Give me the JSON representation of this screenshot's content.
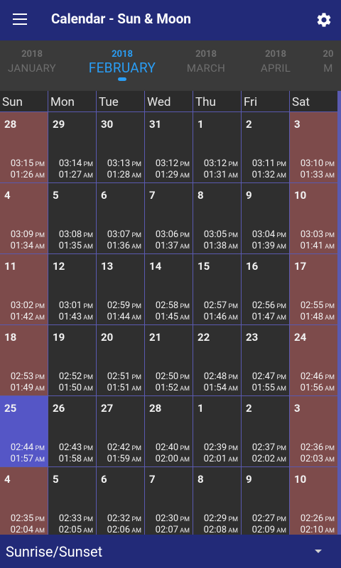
{
  "app": {
    "title": "Calendar - Sun & Moon",
    "menu_icon": "menu-icon",
    "settings_icon": "gear-icon"
  },
  "months": [
    {
      "year": "2018",
      "name": "JANUARY",
      "selected": false
    },
    {
      "year": "2018",
      "name": "FEBRUARY",
      "selected": true
    },
    {
      "year": "2018",
      "name": "MARCH",
      "selected": false
    },
    {
      "year": "2018",
      "name": "APRIL",
      "selected": false
    },
    {
      "year": "20",
      "name": "M",
      "selected": false
    }
  ],
  "weekdays": [
    "Sun",
    "Mon",
    "Tue",
    "Wed",
    "Thu",
    "Fri",
    "Sat"
  ],
  "weeks": [
    [
      {
        "day": "28",
        "t1": "03:15",
        "p1": "PM",
        "t2": "01:26",
        "p2": "AM"
      },
      {
        "day": "29",
        "t1": "03:14",
        "p1": "PM",
        "t2": "01:27",
        "p2": "AM"
      },
      {
        "day": "30",
        "t1": "03:13",
        "p1": "PM",
        "t2": "01:28",
        "p2": "AM"
      },
      {
        "day": "31",
        "t1": "03:12",
        "p1": "PM",
        "t2": "01:29",
        "p2": "AM"
      },
      {
        "day": "1",
        "t1": "03:12",
        "p1": "PM",
        "t2": "01:31",
        "p2": "AM"
      },
      {
        "day": "2",
        "t1": "03:11",
        "p1": "PM",
        "t2": "01:32",
        "p2": "AM"
      },
      {
        "day": "3",
        "t1": "03:10",
        "p1": "PM",
        "t2": "01:33",
        "p2": "AM"
      }
    ],
    [
      {
        "day": "4",
        "t1": "03:09",
        "p1": "PM",
        "t2": "01:34",
        "p2": "AM"
      },
      {
        "day": "5",
        "t1": "03:08",
        "p1": "PM",
        "t2": "01:35",
        "p2": "AM"
      },
      {
        "day": "6",
        "t1": "03:07",
        "p1": "PM",
        "t2": "01:36",
        "p2": "AM"
      },
      {
        "day": "7",
        "t1": "03:06",
        "p1": "PM",
        "t2": "01:37",
        "p2": "AM"
      },
      {
        "day": "8",
        "t1": "03:05",
        "p1": "PM",
        "t2": "01:38",
        "p2": "AM"
      },
      {
        "day": "9",
        "t1": "03:04",
        "p1": "PM",
        "t2": "01:39",
        "p2": "AM"
      },
      {
        "day": "10",
        "t1": "03:03",
        "p1": "PM",
        "t2": "01:41",
        "p2": "AM"
      }
    ],
    [
      {
        "day": "11",
        "t1": "03:02",
        "p1": "PM",
        "t2": "01:42",
        "p2": "AM"
      },
      {
        "day": "12",
        "t1": "03:01",
        "p1": "PM",
        "t2": "01:43",
        "p2": "AM"
      },
      {
        "day": "13",
        "t1": "02:59",
        "p1": "PM",
        "t2": "01:44",
        "p2": "AM"
      },
      {
        "day": "14",
        "t1": "02:58",
        "p1": "PM",
        "t2": "01:45",
        "p2": "AM"
      },
      {
        "day": "15",
        "t1": "02:57",
        "p1": "PM",
        "t2": "01:46",
        "p2": "AM"
      },
      {
        "day": "16",
        "t1": "02:56",
        "p1": "PM",
        "t2": "01:47",
        "p2": "AM"
      },
      {
        "day": "17",
        "t1": "02:55",
        "p1": "PM",
        "t2": "01:48",
        "p2": "AM"
      }
    ],
    [
      {
        "day": "18",
        "t1": "02:53",
        "p1": "PM",
        "t2": "01:49",
        "p2": "AM"
      },
      {
        "day": "19",
        "t1": "02:52",
        "p1": "PM",
        "t2": "01:50",
        "p2": "AM"
      },
      {
        "day": "20",
        "t1": "02:51",
        "p1": "PM",
        "t2": "01:51",
        "p2": "AM"
      },
      {
        "day": "21",
        "t1": "02:50",
        "p1": "PM",
        "t2": "01:52",
        "p2": "AM"
      },
      {
        "day": "22",
        "t1": "02:48",
        "p1": "PM",
        "t2": "01:54",
        "p2": "AM"
      },
      {
        "day": "23",
        "t1": "02:47",
        "p1": "PM",
        "t2": "01:55",
        "p2": "AM"
      },
      {
        "day": "24",
        "t1": "02:46",
        "p1": "PM",
        "t2": "01:56",
        "p2": "AM"
      }
    ],
    [
      {
        "day": "25",
        "t1": "02:44",
        "p1": "PM",
        "t2": "01:57",
        "p2": "AM"
      },
      {
        "day": "26",
        "t1": "02:43",
        "p1": "PM",
        "t2": "01:58",
        "p2": "AM"
      },
      {
        "day": "27",
        "t1": "02:42",
        "p1": "PM",
        "t2": "01:59",
        "p2": "AM"
      },
      {
        "day": "28",
        "t1": "02:40",
        "p1": "PM",
        "t2": "02:00",
        "p2": "AM"
      },
      {
        "day": "1",
        "t1": "02:39",
        "p1": "PM",
        "t2": "02:01",
        "p2": "AM"
      },
      {
        "day": "2",
        "t1": "02:37",
        "p1": "PM",
        "t2": "02:02",
        "p2": "AM"
      },
      {
        "day": "3",
        "t1": "02:36",
        "p1": "PM",
        "t2": "02:03",
        "p2": "AM"
      }
    ],
    [
      {
        "day": "4",
        "t1": "02:35",
        "p1": "PM",
        "t2": "02:04",
        "p2": "AM"
      },
      {
        "day": "5",
        "t1": "02:33",
        "p1": "PM",
        "t2": "02:05",
        "p2": "AM"
      },
      {
        "day": "6",
        "t1": "02:32",
        "p1": "PM",
        "t2": "02:06",
        "p2": "AM"
      },
      {
        "day": "7",
        "t1": "02:30",
        "p1": "PM",
        "t2": "02:07",
        "p2": "AM"
      },
      {
        "day": "8",
        "t1": "02:29",
        "p1": "PM",
        "t2": "02:08",
        "p2": "AM"
      },
      {
        "day": "9",
        "t1": "02:27",
        "p1": "PM",
        "t2": "02:09",
        "p2": "AM"
      },
      {
        "day": "10",
        "t1": "02:26",
        "p1": "PM",
        "t2": "02:10",
        "p2": "AM"
      }
    ]
  ],
  "today": {
    "week": 4,
    "col": 0
  },
  "bottom": {
    "label": "Sunrise/Sunset",
    "arrow_icon": "dropdown-arrow-icon"
  },
  "colors": {
    "appbar": "#222a78",
    "weekend": "#7d4b4b",
    "today": "#5556c6",
    "accent": "#2a9df4",
    "gridline": "#5a5ab0"
  }
}
